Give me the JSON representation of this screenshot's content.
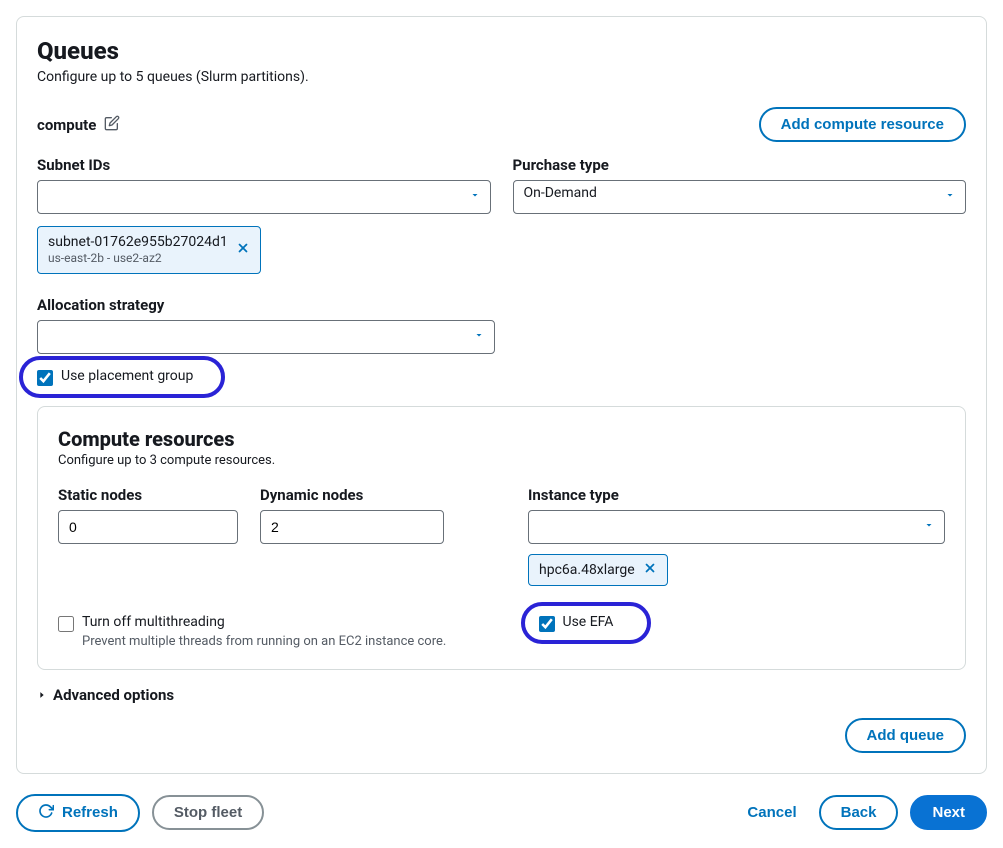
{
  "page": {
    "title": "Queues",
    "subtitle": "Configure up to 5 queues (Slurm partitions)."
  },
  "queue": {
    "name": "compute",
    "addResourceLabel": "Add compute resource"
  },
  "fields": {
    "subnet": {
      "label": "Subnet IDs",
      "value": "",
      "token_main": "subnet-01762e955b27024d1",
      "token_sub": "us-east-2b - use2-az2"
    },
    "purchase": {
      "label": "Purchase type",
      "value": "On-Demand"
    },
    "allocation": {
      "label": "Allocation strategy",
      "value": ""
    },
    "placementGroup": {
      "label": "Use placement group",
      "checked": true
    }
  },
  "compute": {
    "title": "Compute resources",
    "subtitle": "Configure up to 3 compute resources.",
    "staticNodes": {
      "label": "Static nodes",
      "value": "0"
    },
    "dynamicNodes": {
      "label": "Dynamic nodes",
      "value": "2"
    },
    "instanceType": {
      "label": "Instance type",
      "value": "",
      "token": "hpc6a.48xlarge"
    },
    "multithreading": {
      "label": "Turn off multithreading",
      "helper": "Prevent multiple threads from running on an EC2 instance core.",
      "checked": false
    },
    "efa": {
      "label": "Use EFA",
      "checked": true
    }
  },
  "advanced": {
    "label": "Advanced options"
  },
  "addQueue": {
    "label": "Add queue"
  },
  "footer": {
    "refresh": "Refresh",
    "stopFleet": "Stop fleet",
    "cancel": "Cancel",
    "back": "Back",
    "next": "Next"
  }
}
